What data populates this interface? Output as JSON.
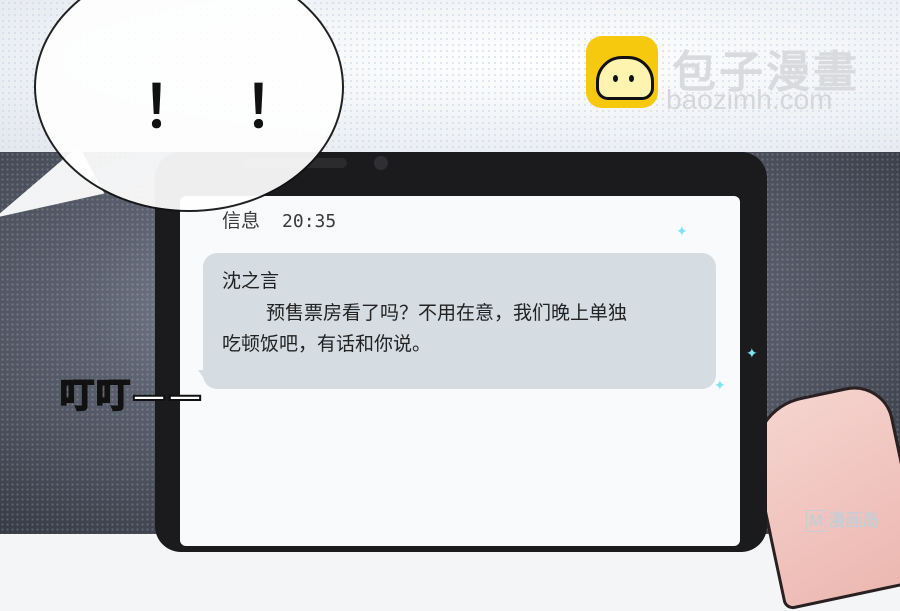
{
  "speech": {
    "exclaim": "！！"
  },
  "brand": {
    "cn": "包子漫畫",
    "en": "baozimh.com"
  },
  "phone": {
    "status_app": "信息",
    "status_time": "20:35",
    "message": {
      "sender": "沈之言",
      "line1": "预售票房看了吗？不用在意，我们晚上单独",
      "line2": "吃顿饭吧，有话和你说。"
    }
  },
  "sfx": "叮叮——",
  "corner_mark": {
    "letter": "M",
    "text": "漫画岛"
  }
}
